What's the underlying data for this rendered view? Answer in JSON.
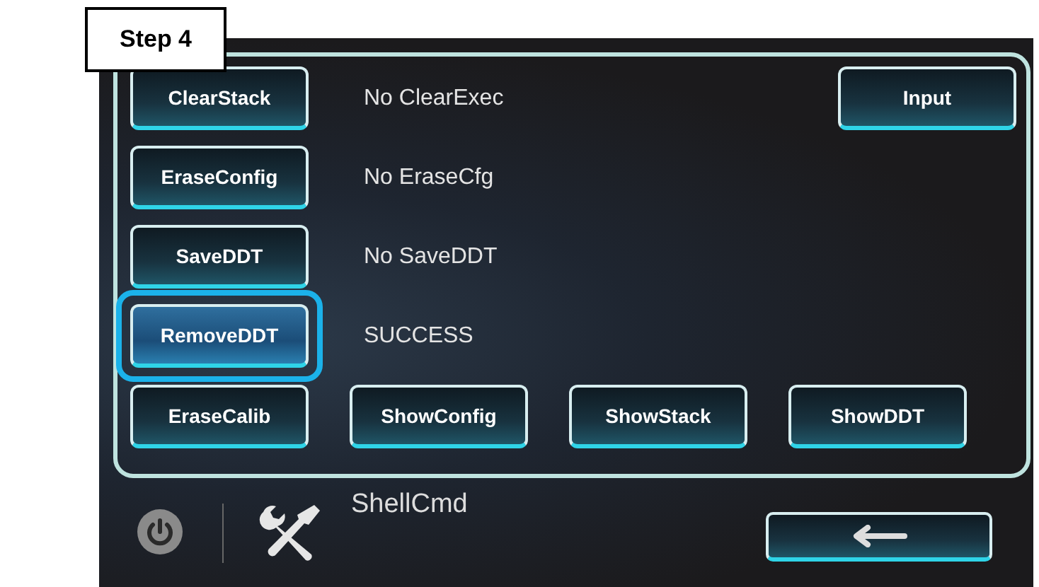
{
  "step_label": "Step 4",
  "rows": [
    {
      "button": {
        "label": "ClearStack",
        "selected": false
      },
      "status": "No ClearExec"
    },
    {
      "button": {
        "label": "EraseConfig",
        "selected": false
      },
      "status": "No EraseCfg"
    },
    {
      "button": {
        "label": "SaveDDT",
        "selected": false
      },
      "status": "No SaveDDT"
    },
    {
      "button": {
        "label": "RemoveDDT",
        "selected": true
      },
      "status": "SUCCESS"
    }
  ],
  "input_button": {
    "label": "Input"
  },
  "bottom_buttons": [
    {
      "label": "EraseCalib",
      "selected": false
    },
    {
      "label": "ShowConfig",
      "selected": false
    },
    {
      "label": "ShowStack",
      "selected": false
    },
    {
      "label": "ShowDDT",
      "selected": false
    }
  ],
  "footer": {
    "title": "ShellCmd"
  }
}
